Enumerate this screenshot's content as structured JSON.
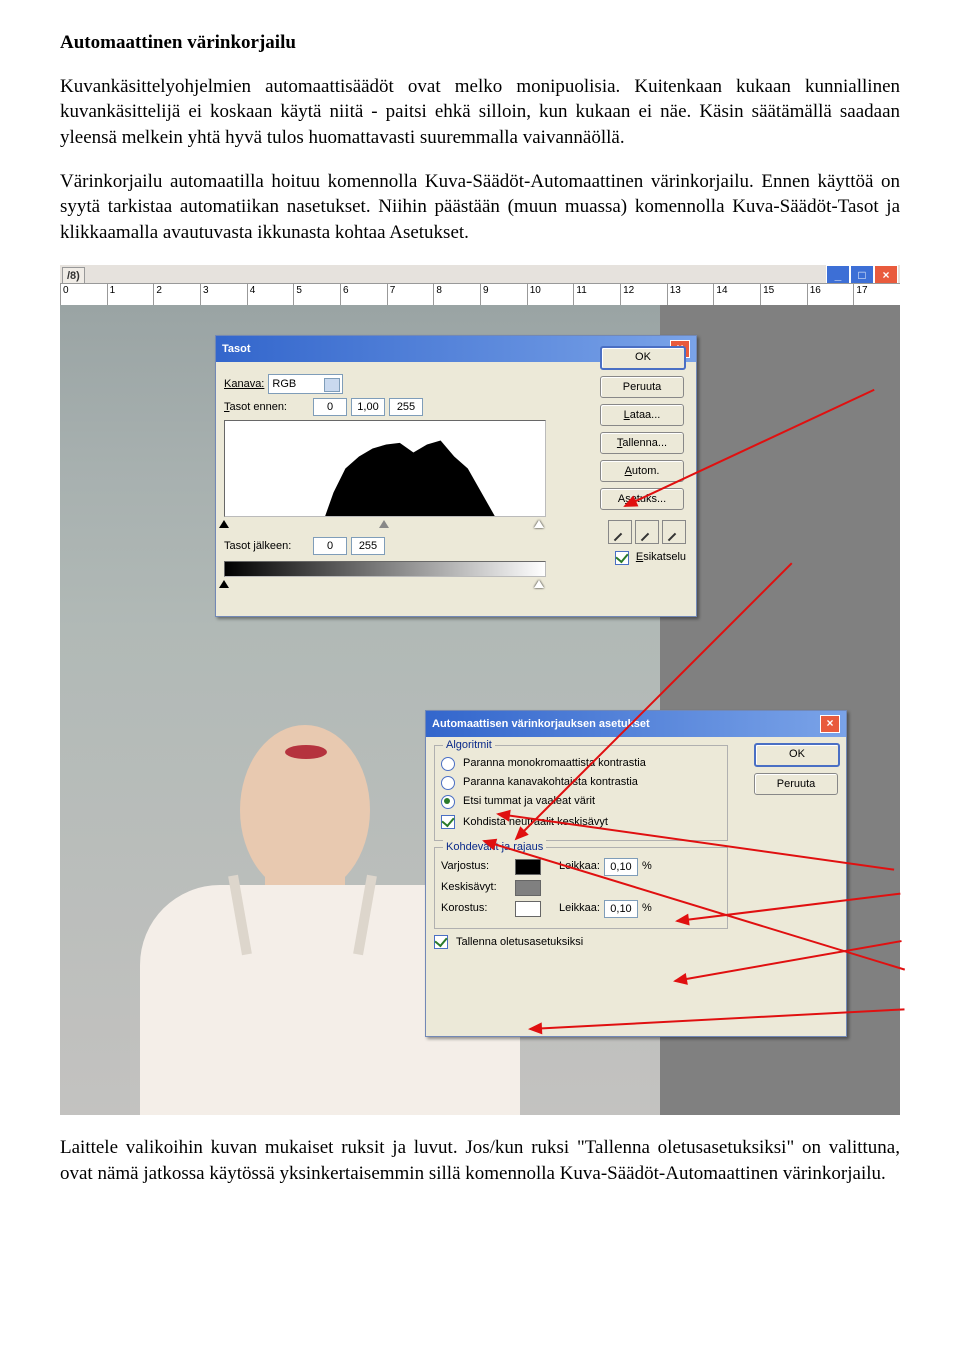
{
  "doc": {
    "heading": "Automaattinen värinkorjailu",
    "p1": "Kuvankäsittelyohjelmien automaattisäädöt ovat melko monipuolisia. Kuitenkaan kukaan kunniallinen kuvankäsittelijä ei koskaan käytä niitä - paitsi ehkä silloin, kun kukaan ei näe. Käsin säätämällä saadaan yleensä melkein yhtä hyvä tulos huomattavasti suuremmalla vaivannäöllä.",
    "p2": "Värinkorjailu automaatilla hoituu komennolla Kuva-Säädöt-Automaattinen värinkorjailu. Ennen käyttöä on syytä tarkistaa automatiikan nasetukset. Niihin päästään (muun muassa) komennolla Kuva-Säädöt-Tasot ja klikkaamalla avautuvasta ikkunasta kohtaa Asetukset.",
    "p3": "Laittele valikoihin kuvan mukaiset ruksit ja luvut. Jos/kun ruksi \"Tallenna oletusasetuksiksi\" on valittuna, ovat nämä jatkossa käytössä yksinkertaisemmin sillä komennolla Kuva-Säädöt-Automaattinen värinkorjailu."
  },
  "editor": {
    "tab": "/8)",
    "ruler": [
      "0",
      "1",
      "2",
      "3",
      "4",
      "5",
      "6",
      "7",
      "8",
      "9",
      "10",
      "11",
      "12",
      "13",
      "14",
      "15",
      "16",
      "17"
    ]
  },
  "levels": {
    "title": "Tasot",
    "channel_label": "Kanava:",
    "channel_value": "RGB",
    "before_label": "Tasot ennen:",
    "before_lo": "0",
    "before_gamma": "1,00",
    "before_hi": "255",
    "after_label": "Tasot jälkeen:",
    "after_lo": "0",
    "after_hi": "255",
    "btn_ok": "OK",
    "btn_cancel": "Peruuta",
    "btn_load": "Lataa...",
    "btn_save": "Tallenna...",
    "btn_auto": "Autom.",
    "btn_options": "Asetuks...",
    "preview": "Esikatselu"
  },
  "auto": {
    "title": "Automaattisen värinkorjauksen asetukset",
    "group_algo": "Algoritmit",
    "opt1": "Paranna monokromaattista kontrastia",
    "opt2": "Paranna kanavakohtaista kontrastia",
    "opt3": "Etsi tummat ja vaaleat värit",
    "chk_midtones": "Kohdista neutraalit keskisävyt",
    "group_colors": "Kohdevärit ja rajaus",
    "shadows": "Varjostus:",
    "midtones": "Keskisävyt:",
    "highlights": "Korostus:",
    "clip": "Leikkaa:",
    "clip_shadow_val": "0,10",
    "clip_high_val": "0,10",
    "pct": "%",
    "chk_save": "Tallenna oletusasetuksiksi",
    "btn_ok": "OK",
    "btn_cancel": "Peruuta"
  }
}
